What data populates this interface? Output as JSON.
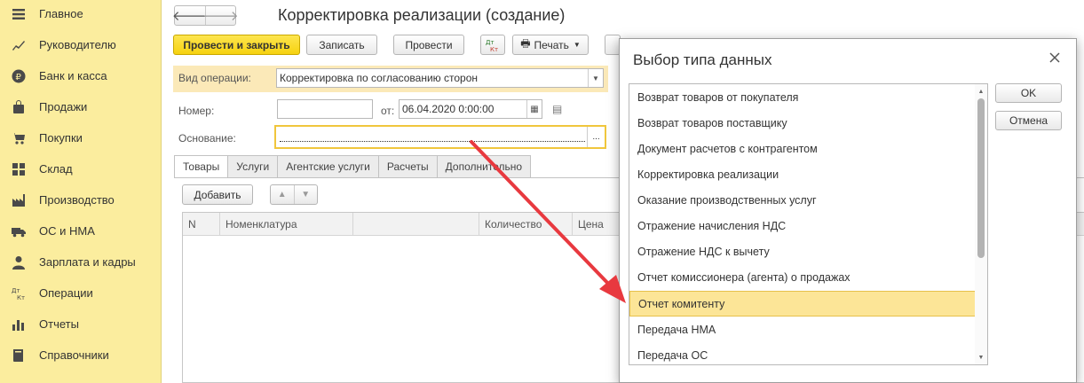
{
  "sidebar": {
    "items": [
      {
        "label": "Главное",
        "icon": "menu-icon"
      },
      {
        "label": "Руководителю",
        "icon": "chart-up-icon"
      },
      {
        "label": "Банк и касса",
        "icon": "ruble-icon"
      },
      {
        "label": "Продажи",
        "icon": "bag-icon"
      },
      {
        "label": "Покупки",
        "icon": "cart-icon"
      },
      {
        "label": "Склад",
        "icon": "grid-icon"
      },
      {
        "label": "Производство",
        "icon": "factory-icon"
      },
      {
        "label": "ОС и НМА",
        "icon": "truck-icon"
      },
      {
        "label": "Зарплата и кадры",
        "icon": "person-icon"
      },
      {
        "label": "Операции",
        "icon": "dt-kt-icon"
      },
      {
        "label": "Отчеты",
        "icon": "bar-chart-icon"
      },
      {
        "label": "Справочники",
        "icon": "book-icon"
      }
    ]
  },
  "header": {
    "title": "Корректировка реализации (создание)"
  },
  "toolbar": {
    "post_close": "Провести и закрыть",
    "save": "Записать",
    "post": "Провести",
    "dtkt": "Дт Кт",
    "print": "Печать"
  },
  "form": {
    "operation_label": "Вид операции:",
    "operation_value": "Корректировка по согласованию сторон",
    "number_label": "Номер:",
    "number_value": "",
    "date_label": "от:",
    "date_value": "06.04.2020  0:00:00",
    "basis_label": "Основание:",
    "basis_value": "",
    "basis_select": "..."
  },
  "tabs": [
    "Товары",
    "Услуги",
    "Агентские услуги",
    "Расчеты",
    "Дополнительно"
  ],
  "table": {
    "add_button": "Добавить",
    "columns": [
      "N",
      "Номенклатура",
      "",
      "Количество",
      "Цена"
    ]
  },
  "dialog": {
    "title": "Выбор типа данных",
    "ok": "OK",
    "cancel": "Отмена",
    "items": [
      "Возврат товаров от покупателя",
      "Возврат товаров поставщику",
      "Документ расчетов с контрагентом",
      "Корректировка реализации",
      "Оказание производственных услуг",
      "Отражение начисления НДС",
      "Отражение НДС к вычету",
      "Отчет комиссионера (агента) о продажах",
      "Отчет комитенту",
      "Передача НМА",
      "Передача ОС"
    ],
    "selected_index": 8
  },
  "colors": {
    "sidebar_bg": "#fbed9e",
    "primary_button": "#f6d20f",
    "selection": "#fce597",
    "arrow": "#e8393f"
  }
}
